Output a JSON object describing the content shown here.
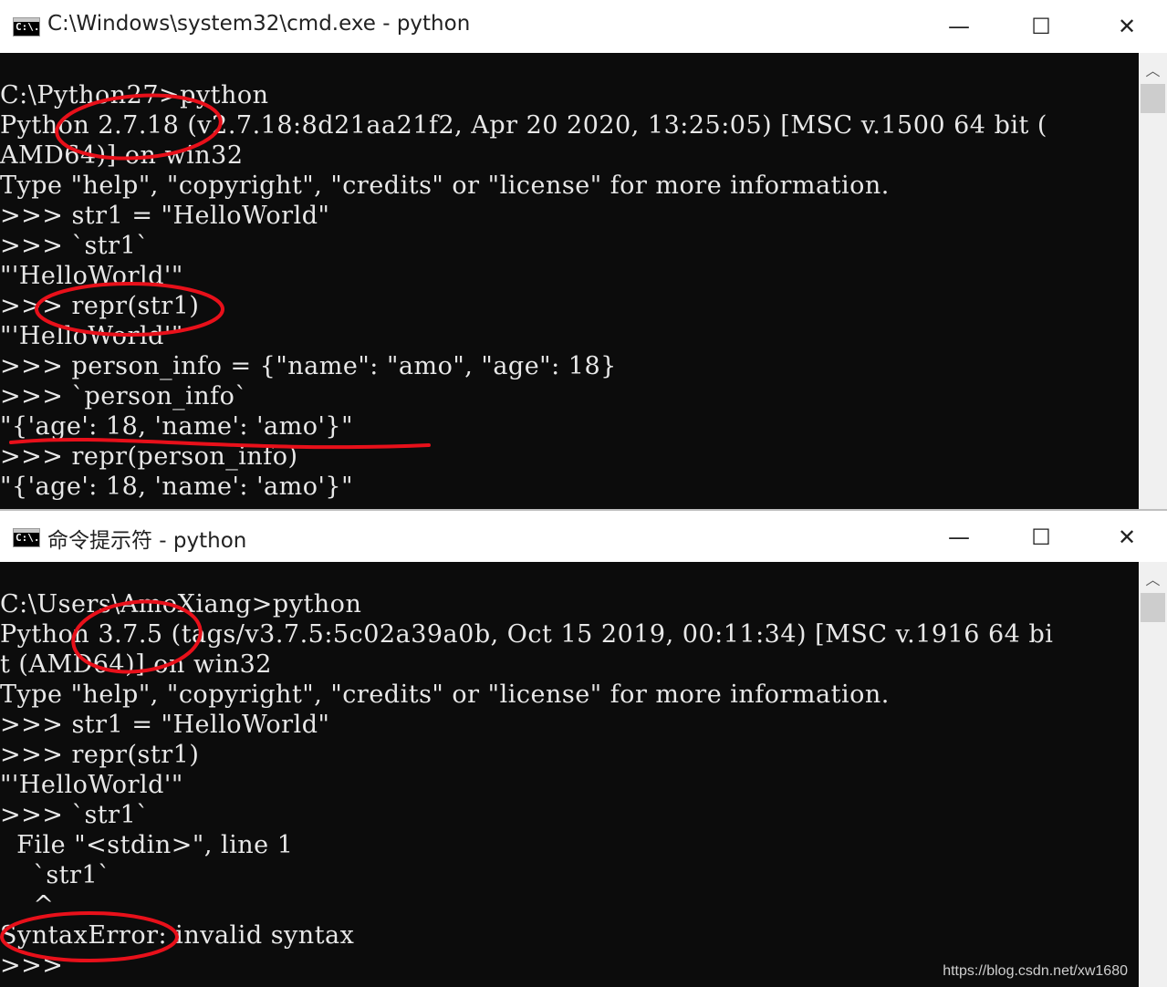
{
  "windows": [
    {
      "title": "C:\\Windows\\system32\\cmd.exe - python",
      "icon_text": "C:\\.",
      "buttons": {
        "minimize": "—",
        "maximize": "☐",
        "close": "✕"
      },
      "lines": [
        "C:\\Python27>python",
        "Python 2.7.18 (v2.7.18:8d21aa21f2, Apr 20 2020, 13:25:05) [MSC v.1500 64 bit (",
        "AMD64)] on win32",
        "Type \"help\", \"copyright\", \"credits\" or \"license\" for more information.",
        ">>> str1 = \"HelloWorld\"",
        ">>> `str1`",
        "\"'HelloWorld'\"",
        ">>> repr(str1)",
        "\"'HelloWorld'\"",
        ">>> person_info = {\"name\": \"amo\", \"age\": 18}",
        ">>> `person_info`",
        "\"{'age': 18, 'name': 'amo'}\"",
        ">>> repr(person_info)",
        "\"{'age': 18, 'name': 'amo'}\""
      ]
    },
    {
      "title": "命令提示符 - python",
      "icon_text": "C:\\.",
      "buttons": {
        "minimize": "—",
        "maximize": "☐",
        "close": "✕"
      },
      "lines": [
        "C:\\Users\\AmoXiang>python",
        "Python 3.7.5 (tags/v3.7.5:5c02a39a0b, Oct 15 2019, 00:11:34) [MSC v.1916 64 bi",
        "t (AMD64)] on win32",
        "Type \"help\", \"copyright\", \"credits\" or \"license\" for more information.",
        ">>> str1 = \"HelloWorld\"",
        ">>> repr(str1)",
        "\"'HelloWorld'\"",
        ">>> `str1`",
        "  File \"<stdin>\", line 1",
        "    `str1`",
        "    ^",
        "SyntaxError: invalid syntax",
        ">>>"
      ]
    }
  ],
  "watermark": "https://blog.csdn.net/xw1680",
  "colors": {
    "console_bg": "#0c0c0c",
    "console_text": "#e8e8e8",
    "annotation": "#e8101a"
  }
}
